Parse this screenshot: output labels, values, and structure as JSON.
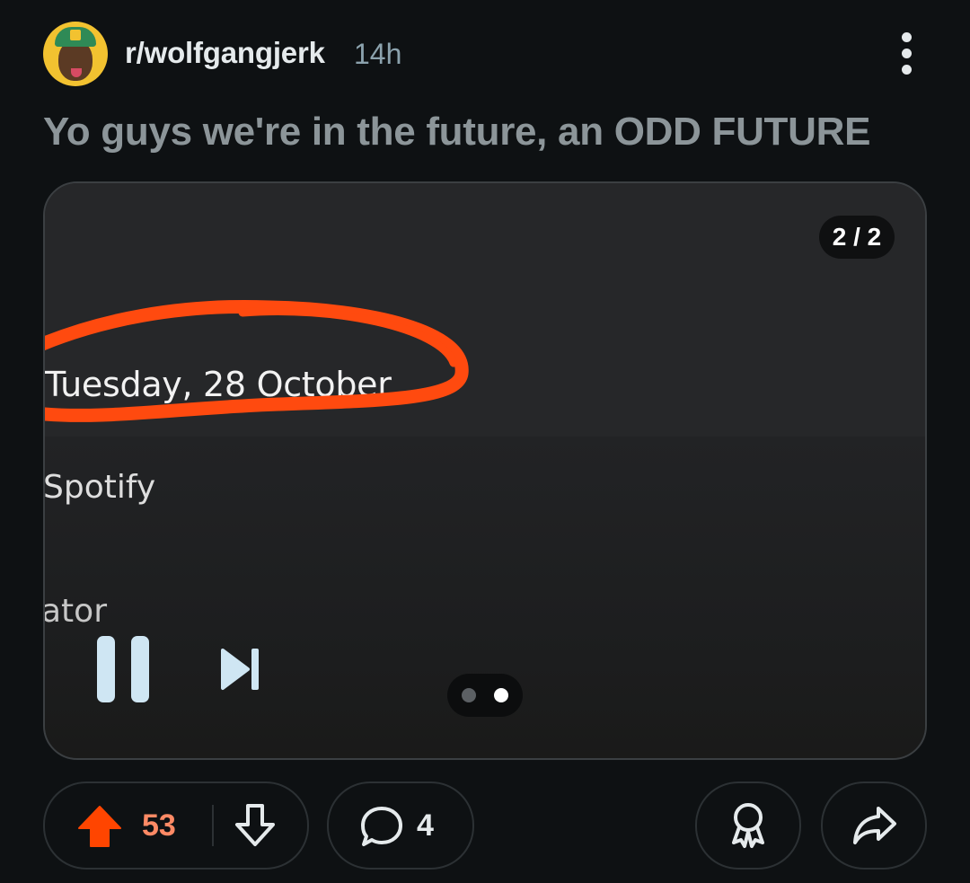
{
  "post": {
    "subreddit": "r/wolfgangjerk",
    "age": "14h",
    "title": "Yo guys we're in the future, an ODD FUTURE"
  },
  "media": {
    "counter": "2 / 2",
    "screenshot_text": {
      "date": "Tuesday, 28 October",
      "app_name": "Spotify",
      "partial_text": "ator"
    },
    "carousel": {
      "total": 2,
      "active_index": 2
    }
  },
  "actions": {
    "upvotes": "53",
    "comments": "4"
  },
  "colors": {
    "background": "#0e1113",
    "upvote_active": "#ff4500",
    "vote_count": "#ff8a65",
    "annotation_circle": "#ff4a0f"
  },
  "icons": [
    "more-options-icon",
    "upvote-icon",
    "downvote-icon",
    "comment-icon",
    "award-icon",
    "share-icon",
    "pause-icon",
    "skip-next-icon"
  ]
}
